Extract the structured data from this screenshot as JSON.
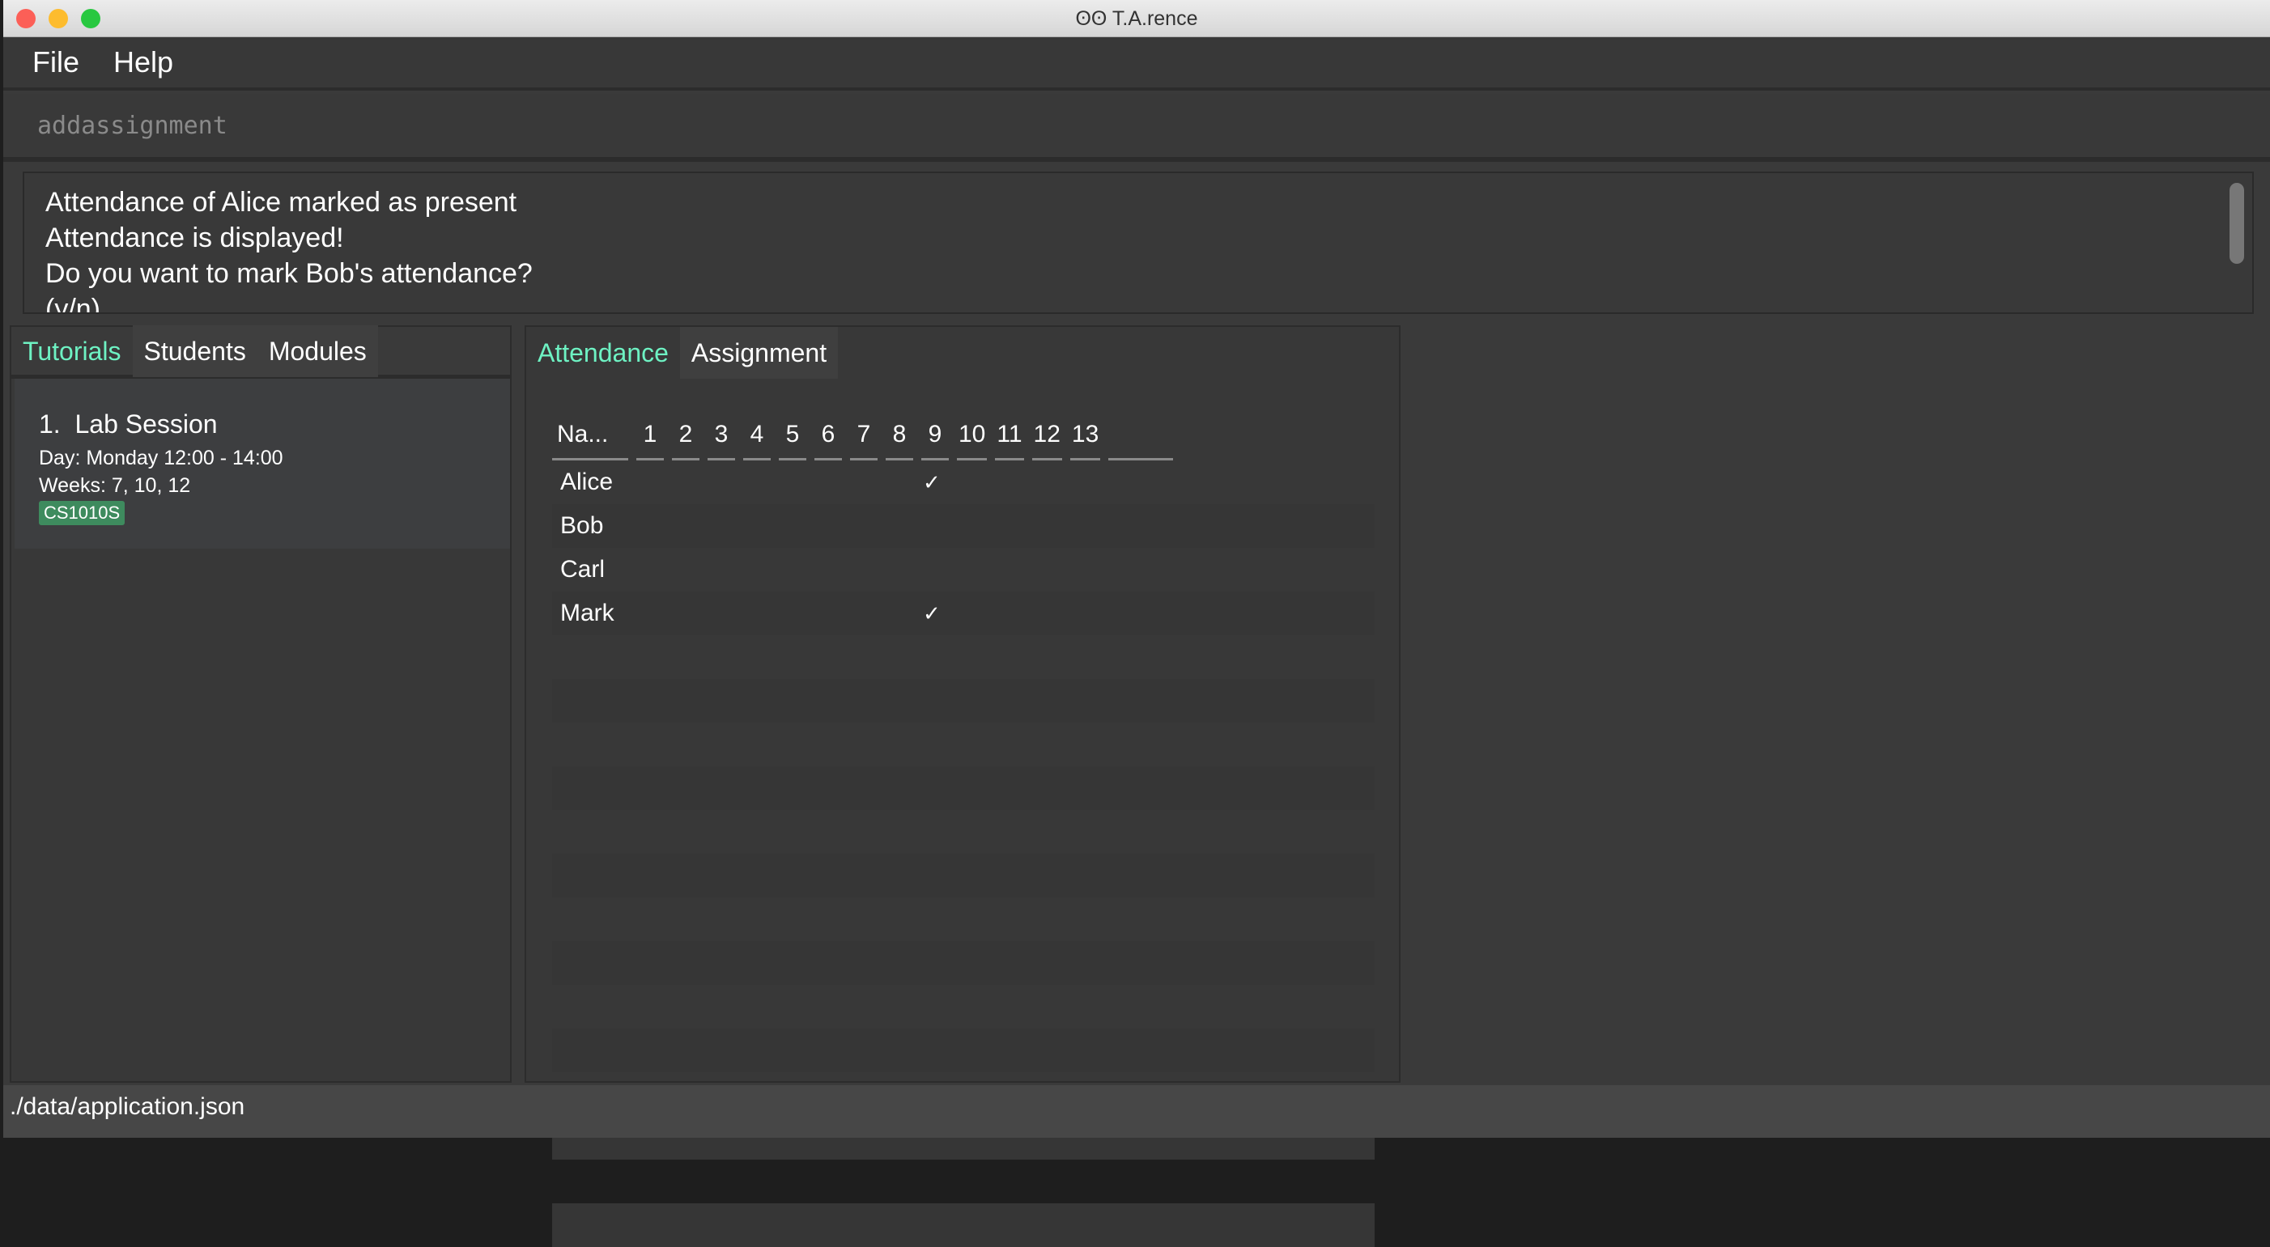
{
  "window": {
    "title": "T.A.rence",
    "title_icon": "glasses-icon"
  },
  "menu": [
    "File",
    "Help"
  ],
  "command": {
    "value": "addassignment"
  },
  "result": [
    "Attendance of Alice marked as present",
    "Attendance is displayed!",
    "Do you want to mark Bob's attendance?",
    "(y/n)"
  ],
  "left_tabs": [
    {
      "label": "Tutorials",
      "active": true
    },
    {
      "label": "Students"
    },
    {
      "label": "Modules"
    }
  ],
  "tutorial": {
    "index": "1.",
    "name": "Lab Session",
    "day": "Day: Monday 12:00 - 14:00",
    "weeks": "Weeks: 7, 10, 12",
    "module": "CS1010S"
  },
  "right_tabs": [
    {
      "label": "Attendance",
      "active": true
    },
    {
      "label": "Assignment"
    }
  ],
  "attendance": {
    "columns": [
      "Na...",
      "1",
      "2",
      "3",
      "4",
      "5",
      "6",
      "7",
      "8",
      "9",
      "10",
      "11",
      "12",
      "13",
      ""
    ],
    "rows": [
      {
        "name": "Alice",
        "mark": "✓"
      },
      {
        "name": "Bob",
        "mark": ""
      },
      {
        "name": "Carl",
        "mark": ""
      },
      {
        "name": "Mark",
        "mark": "✓"
      }
    ]
  },
  "status": "./data/application.json",
  "colors": {
    "accent": "#6ef2c3",
    "tag": "#3e8b5e"
  }
}
